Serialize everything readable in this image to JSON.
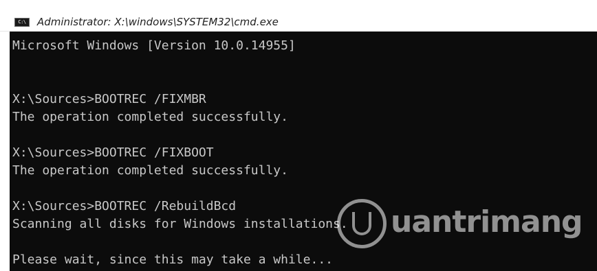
{
  "window": {
    "title": "Administrator: X:\\windows\\SYSTEM32\\cmd.exe",
    "icon_text": "C:\\",
    "icon": "cmd-console-icon"
  },
  "console": {
    "lines": [
      "Microsoft Windows [Version 10.0.14955]",
      "",
      "",
      "X:\\Sources>BOOTREC /FIXMBR",
      "The operation completed successfully.",
      "",
      "X:\\Sources>BOOTREC /FIXBOOT",
      "The operation completed successfully.",
      "",
      "X:\\Sources>BOOTREC /RebuildBcd",
      "Scanning all disks for Windows installations.",
      "",
      "Please wait, since this may take a while..."
    ]
  },
  "watermark": {
    "text": "uantrimang",
    "icon": "quantrimang-logo-icon"
  },
  "colors": {
    "console_bg": "#0c0c0c",
    "console_text": "#c8c8c8",
    "titlebar_bg": "#ffffff"
  }
}
